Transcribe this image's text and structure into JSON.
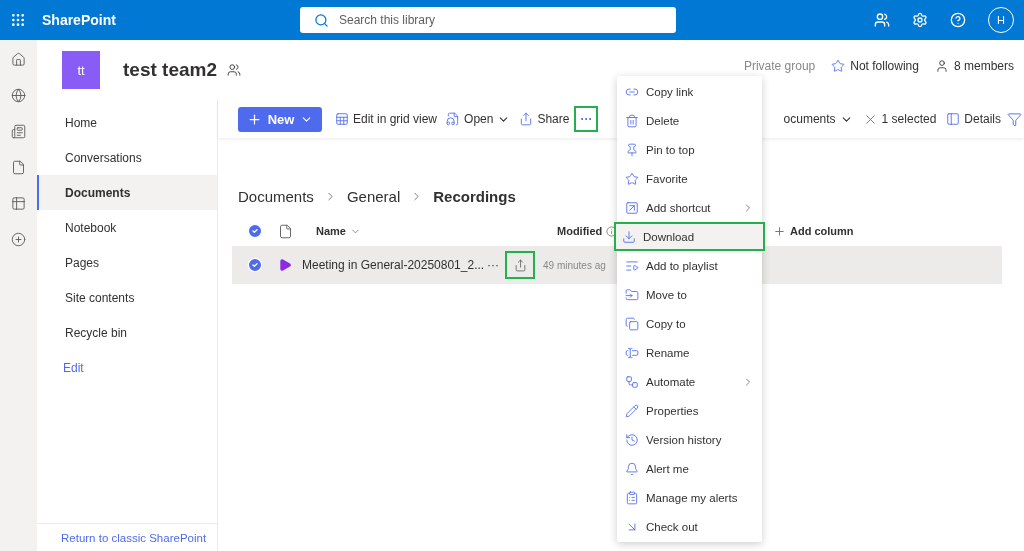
{
  "topbar": {
    "app_name": "SharePoint",
    "search_placeholder": "Search this library",
    "avatar": "H"
  },
  "site": {
    "logo": "tt",
    "title": "test team2",
    "privacy": "Private group",
    "follow": "Not following",
    "members": "8 members"
  },
  "nav": {
    "items": [
      {
        "label": "Home",
        "selected": false
      },
      {
        "label": "Conversations",
        "selected": false
      },
      {
        "label": "Documents",
        "selected": true
      },
      {
        "label": "Notebook",
        "selected": false
      },
      {
        "label": "Pages",
        "selected": false
      },
      {
        "label": "Site contents",
        "selected": false
      },
      {
        "label": "Recycle bin",
        "selected": false
      }
    ],
    "edit": "Edit",
    "footer": "Return to classic SharePoint"
  },
  "toolbar": {
    "new": "New",
    "actions": [
      {
        "label": "Edit in grid view",
        "dropdown": false
      },
      {
        "label": "Open",
        "dropdown": true
      },
      {
        "label": "Share",
        "dropdown": false
      }
    ],
    "more": {
      "label": "···",
      "highlighted": true
    },
    "view": "ocuments",
    "selection": "1 selected",
    "details": "Details"
  },
  "breadcrumb": [
    {
      "label": "Documents",
      "current": false
    },
    {
      "label": "General",
      "current": false
    },
    {
      "label": "Recordings",
      "current": true
    }
  ],
  "table": {
    "all_selected": true,
    "columns": {
      "name": "Name",
      "modified": "Modified",
      "add": "Add column"
    },
    "rows": [
      {
        "name": "Meeting in General-20250801_2...",
        "modified": "49 minutes ag",
        "selected": true,
        "share_highlighted": true,
        "more": "···"
      }
    ]
  },
  "menu": {
    "items": [
      {
        "label": "Copy link",
        "submenu": false,
        "highlighted": false
      },
      {
        "label": "Delete",
        "submenu": false,
        "highlighted": false
      },
      {
        "label": "Pin to top",
        "submenu": false,
        "highlighted": false
      },
      {
        "label": "Favorite",
        "submenu": false,
        "highlighted": false
      },
      {
        "label": "Add shortcut",
        "submenu": true,
        "highlighted": false
      },
      {
        "label": "Download",
        "submenu": false,
        "highlighted": true
      },
      {
        "label": "Add to playlist",
        "submenu": false,
        "highlighted": false
      },
      {
        "label": "Move to",
        "submenu": false,
        "highlighted": false
      },
      {
        "label": "Copy to",
        "submenu": false,
        "highlighted": false
      },
      {
        "label": "Rename",
        "submenu": false,
        "highlighted": false
      },
      {
        "label": "Automate",
        "submenu": true,
        "highlighted": false
      },
      {
        "label": "Properties",
        "submenu": false,
        "highlighted": false
      },
      {
        "label": "Version history",
        "submenu": false,
        "highlighted": false
      },
      {
        "label": "Alert me",
        "submenu": false,
        "highlighted": false
      },
      {
        "label": "Manage my alerts",
        "submenu": false,
        "highlighted": false
      },
      {
        "label": "Check out",
        "submenu": false,
        "highlighted": false
      }
    ]
  }
}
